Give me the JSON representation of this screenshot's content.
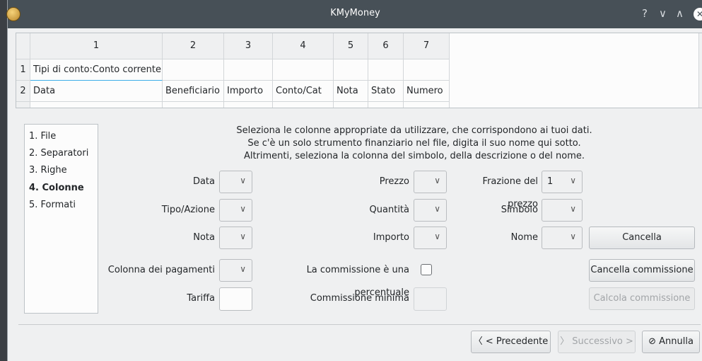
{
  "window": {
    "title": "KMyMoney",
    "help_glyph": "?",
    "min_glyph": "∨",
    "max_glyph": "∧",
    "close_glyph": "✕"
  },
  "grid": {
    "columns": [
      "1",
      "2",
      "3",
      "4",
      "5",
      "6",
      "7"
    ],
    "rows": [
      {
        "num": "1",
        "cells": [
          "Tipi di conto:Conto corrente",
          "",
          "",
          "",
          "",
          "",
          ""
        ]
      },
      {
        "num": "2",
        "cells": [
          "Data",
          "Beneficiario",
          "Importo",
          "Conto/Cat",
          "Nota",
          "Stato",
          "Numero"
        ]
      }
    ]
  },
  "nav": {
    "items": [
      {
        "label": "1. File",
        "active": false
      },
      {
        "label": "2. Separatori",
        "active": false
      },
      {
        "label": "3. Righe",
        "active": false
      },
      {
        "label": "4. Colonne",
        "active": true
      },
      {
        "label": "5. Formati",
        "active": false
      }
    ]
  },
  "intro": {
    "line1": "Seleziona le colonne appropriate da utilizzare, che corrispondono ai tuoi dati.",
    "line2": "Se c'è un solo strumento finanziario nel file, digita il suo nome qui sotto.",
    "line3": "Altrimenti, seleziona la colonna del simbolo, della descrizione o del nome."
  },
  "form": {
    "data_label": "Data",
    "tipo_label": "Tipo/Azione",
    "nota_label": "Nota",
    "prezzo_label": "Prezzo",
    "quantita_label": "Quantità",
    "importo_label": "Importo",
    "frazione_label": "Frazione del prezzo",
    "frazione_value": "1",
    "simbolo_label": "Simbolo",
    "nome_label": "Nome",
    "colonna_pagamenti_label": "Colonna dei pagamenti",
    "commissione_percentuale_label": "La commissione è una percentuale",
    "tariffa_label": "Tariffa",
    "commissione_minima_label": "Commissione minima",
    "arrow_glyph": "∨"
  },
  "buttons": {
    "cancella": "Cancella",
    "cancella_commissione": "Cancella commissione",
    "calcola_commissione": "Calcola commissione",
    "precedente": "< Precedente",
    "successivo": "Successivo >",
    "annulla": "Annulla",
    "back_glyph": "〈",
    "next_glyph": "〉",
    "cancel_glyph": "⊘"
  }
}
